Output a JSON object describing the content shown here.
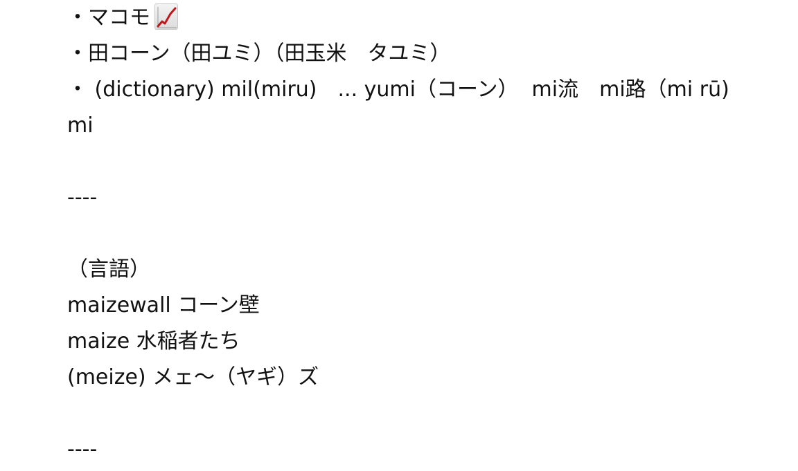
{
  "lines": [
    "・マコモ",
    "・田コーン（田ユミ）（田玉米　タユミ）",
    "・ (dictionary) mil(miru)　... yumi（コーン）  mi流　mi路（mi rū)",
    "mi",
    "----",
    "（言語）",
    "maizewall コーン壁",
    "maize 水稲者たち",
    "(meize) メェ〜（ヤギ）ズ",
    "----"
  ],
  "emoji": {
    "name": "chart-increasing-icon",
    "color": "#c0161c"
  }
}
